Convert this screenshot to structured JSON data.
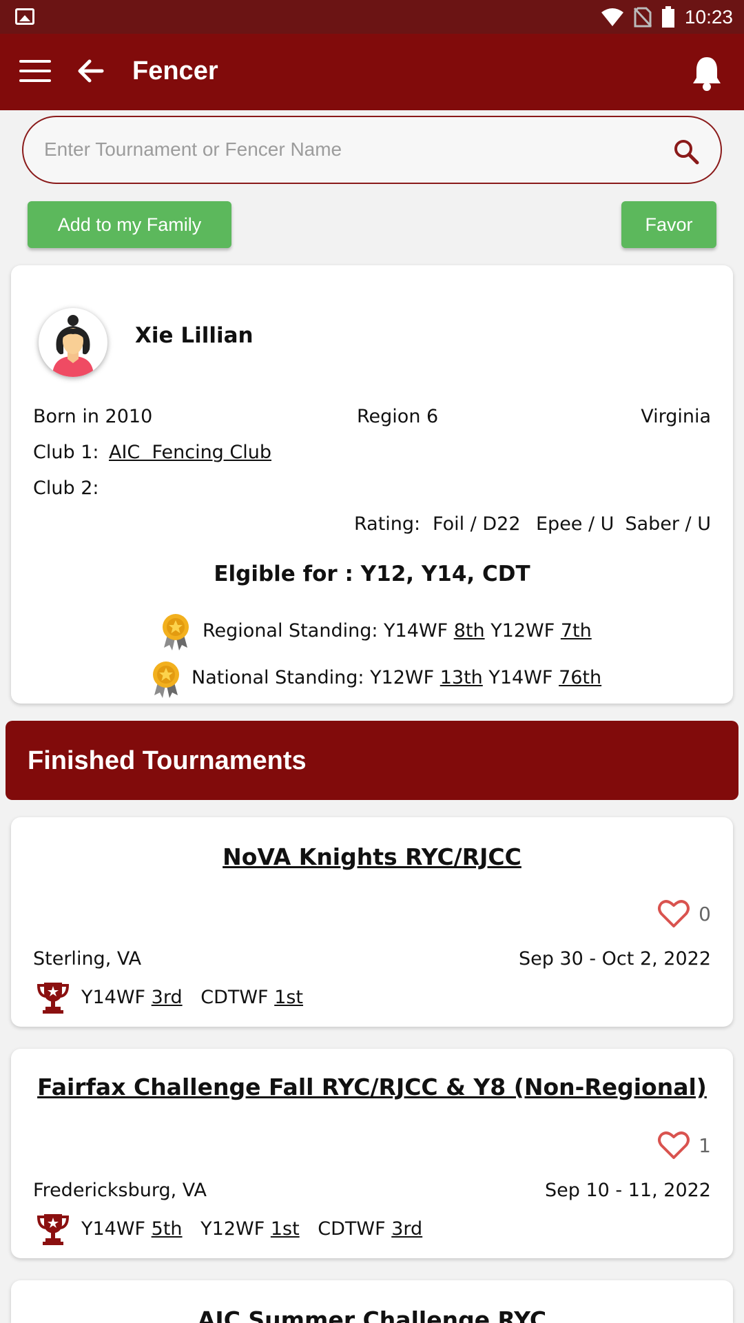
{
  "status_bar": {
    "time": "10:23"
  },
  "app_bar": {
    "title": "Fencer"
  },
  "search": {
    "placeholder": "Enter Tournament or Fencer Name"
  },
  "actions": {
    "add_family": "Add to my Family",
    "favor": "Favor"
  },
  "profile": {
    "name": "Xie Lillian",
    "born": "Born in 2010",
    "region": "Region 6",
    "state": "Virginia",
    "club1_label": "Club 1:",
    "club1_value": "AIC  Fencing Club",
    "club2_label": "Club 2:",
    "rating_label": "Rating:",
    "rating_foil": "Foil / D22",
    "rating_epee": "Epee / U",
    "rating_saber": "Saber / U",
    "eligible": "Elgible for : Y12, Y14, CDT",
    "regional": {
      "label": "Regional Standing:",
      "e1": "Y14WF",
      "r1": "8th",
      "e2": "Y12WF",
      "r2": "7th"
    },
    "national": {
      "label": "National Standing:",
      "e1": "Y12WF",
      "r1": "13th",
      "e2": "Y14WF",
      "r2": "76th"
    }
  },
  "section_title": "Finished Tournaments",
  "tournaments": [
    {
      "name": "NoVA Knights RYC/RJCC",
      "likes": "0",
      "location": "Sterling, VA",
      "dates": "Sep 30 - Oct 2, 2022",
      "results": [
        {
          "event": "Y14WF",
          "place": "3rd"
        },
        {
          "event": "CDTWF",
          "place": "1st"
        }
      ]
    },
    {
      "name": "Fairfax Challenge Fall RYC/RJCC & Y8 (Non-Regional)",
      "likes": "1",
      "location": "Fredericksburg, VA",
      "dates": "Sep 10 - 11, 2022",
      "results": [
        {
          "event": "Y14WF",
          "place": "5th"
        },
        {
          "event": "Y12WF",
          "place": "1st"
        },
        {
          "event": "CDTWF",
          "place": "3rd"
        }
      ]
    },
    {
      "name": "AIC Summer Challenge RYC"
    }
  ],
  "colors": {
    "primary": "#810b0b",
    "status_bar": "#6b1414",
    "button_green": "#5cb85c",
    "heart": "#d9534f"
  }
}
